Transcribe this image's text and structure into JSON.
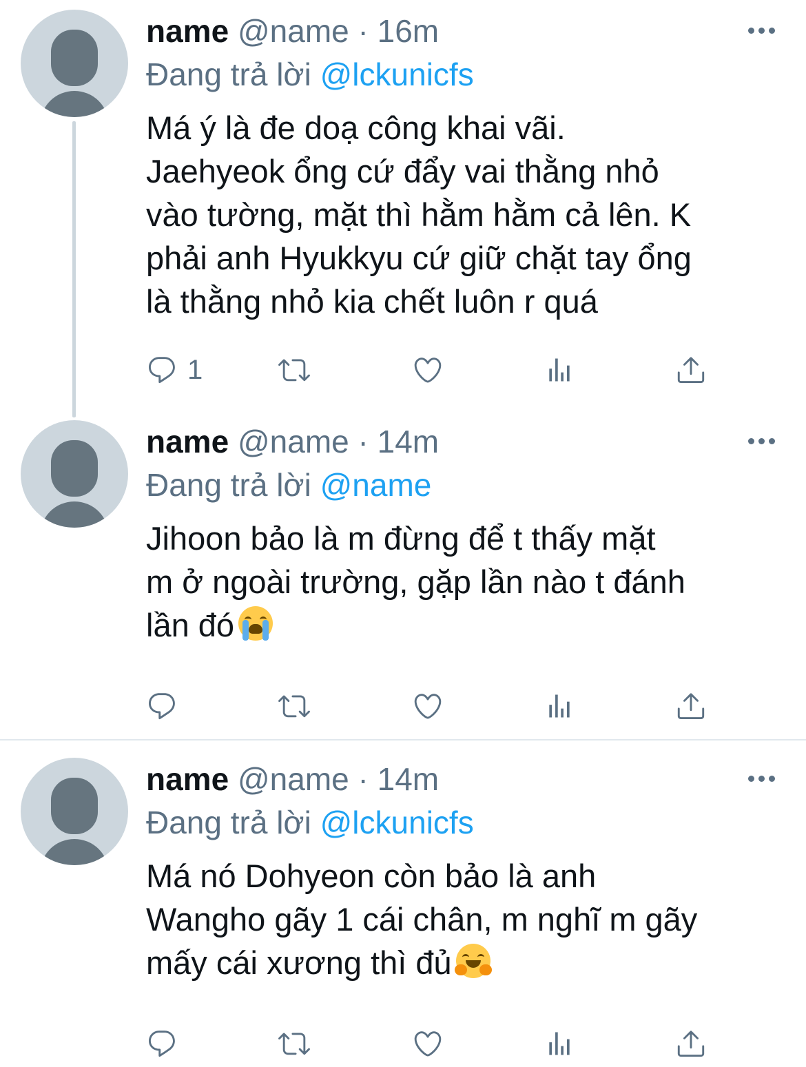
{
  "tweets": [
    {
      "display_name": "name",
      "handle": "@name",
      "separator": "·",
      "time": "16m",
      "reply_prefix": "Đang trả lời",
      "reply_to": "@lckunicfs",
      "text": "Má ý là đe doạ công khai vãi.\nJaehyeok ổng cứ đẩy vai thằng nhỏ\nvào tường, mặt thì hằm hằm cả lên. K\nphải anh Hyukkyu cứ giữ chặt tay ổng\nlà thằng nhỏ kia chết luôn r quá",
      "emoji": "",
      "reply_count": "1"
    },
    {
      "display_name": "name",
      "handle": "@name",
      "separator": "·",
      "time": "14m",
      "reply_prefix": "Đang trả lời",
      "reply_to": "@name",
      "text": "Jihoon bảo là m đừng để t thấy mặt\nm ở ngoài trường, gặp lần nào t đánh\nlần đó",
      "emoji": "loudly-crying-face",
      "reply_count": ""
    },
    {
      "display_name": "name",
      "handle": "@name",
      "separator": "·",
      "time": "14m",
      "reply_prefix": "Đang trả lời",
      "reply_to": "@lckunicfs",
      "text": "Má nó Dohyeon còn bảo là anh\nWangho gãy 1 cái chân, m nghĩ m gãy\nmấy cái xương thì đủ",
      "emoji": "hugging-face",
      "reply_count": ""
    }
  ],
  "icons": {
    "reply": "reply-icon",
    "retweet": "retweet-icon",
    "like": "like-icon",
    "analytics": "analytics-icon",
    "share": "share-icon",
    "more": "more-icon"
  },
  "colors": {
    "link": "#1da1f2",
    "secondary_text": "#5b7083",
    "avatar_bg": "#ccd6dd",
    "avatar_fg": "#66757f",
    "divider": "#e1e8ed"
  }
}
